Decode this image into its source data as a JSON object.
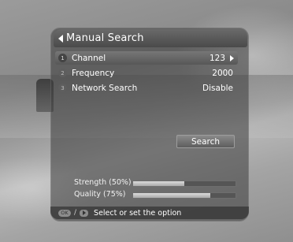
{
  "window": {
    "title": "Manual Search"
  },
  "rows": [
    {
      "num": "1",
      "label": "Channel",
      "value": "123"
    },
    {
      "num": "2",
      "label": "Frequency",
      "value": "2000"
    },
    {
      "num": "3",
      "label": "Network Search",
      "value": "Disable"
    }
  ],
  "search_button": "Search",
  "meters": {
    "strength": {
      "label": "Strength (50%)",
      "level": 0.5
    },
    "quality": {
      "label": "Quality (75%)",
      "level": 0.75
    }
  },
  "footer": {
    "ok_key": "OK",
    "separator": "/",
    "hint": "Select or set the option"
  }
}
